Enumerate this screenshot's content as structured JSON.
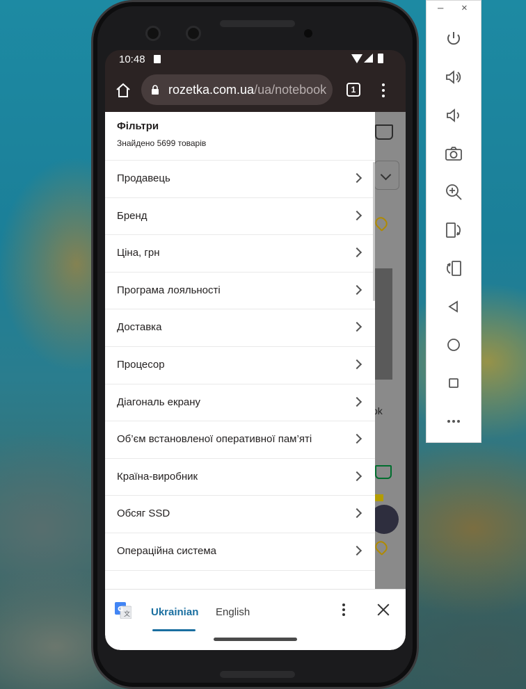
{
  "statusbar": {
    "time": "10:48"
  },
  "browser": {
    "url_host": "rozetka.com.ua",
    "url_path": "/ua/notebook",
    "tab_count": "1"
  },
  "background_page": {
    "partial_text": "ok"
  },
  "filters": {
    "title": "Фільтри",
    "subtitle": "Знайдено 5699 товарів",
    "items": [
      {
        "label": "Продавець"
      },
      {
        "label": "Бренд"
      },
      {
        "label": "Ціна, грн"
      },
      {
        "label": "Програма лояльності"
      },
      {
        "label": "Доставка"
      },
      {
        "label": "Процесор"
      },
      {
        "label": "Діагональ екрану"
      },
      {
        "label": "Об’єм встановленої оперативної пам’яті"
      },
      {
        "label": "Країна-виробник"
      },
      {
        "label": "Обсяг SSD"
      },
      {
        "label": "Операційна система"
      }
    ]
  },
  "translate_bar": {
    "source_language": "Ukrainian",
    "target_language": "English"
  },
  "emulator_panel": {
    "minimize_label": "–",
    "close_label": "×",
    "controls": [
      "power-icon",
      "volume-up-icon",
      "volume-down-icon",
      "camera-icon",
      "zoom-icon",
      "rotate-left-icon",
      "rotate-right-icon",
      "back-icon",
      "home-icon",
      "overview-icon",
      "more-icon"
    ]
  },
  "colors": {
    "accent_blue": "#1a6fa0",
    "browser_toolbar": "#2b2323",
    "url_pill": "#473c3c"
  }
}
